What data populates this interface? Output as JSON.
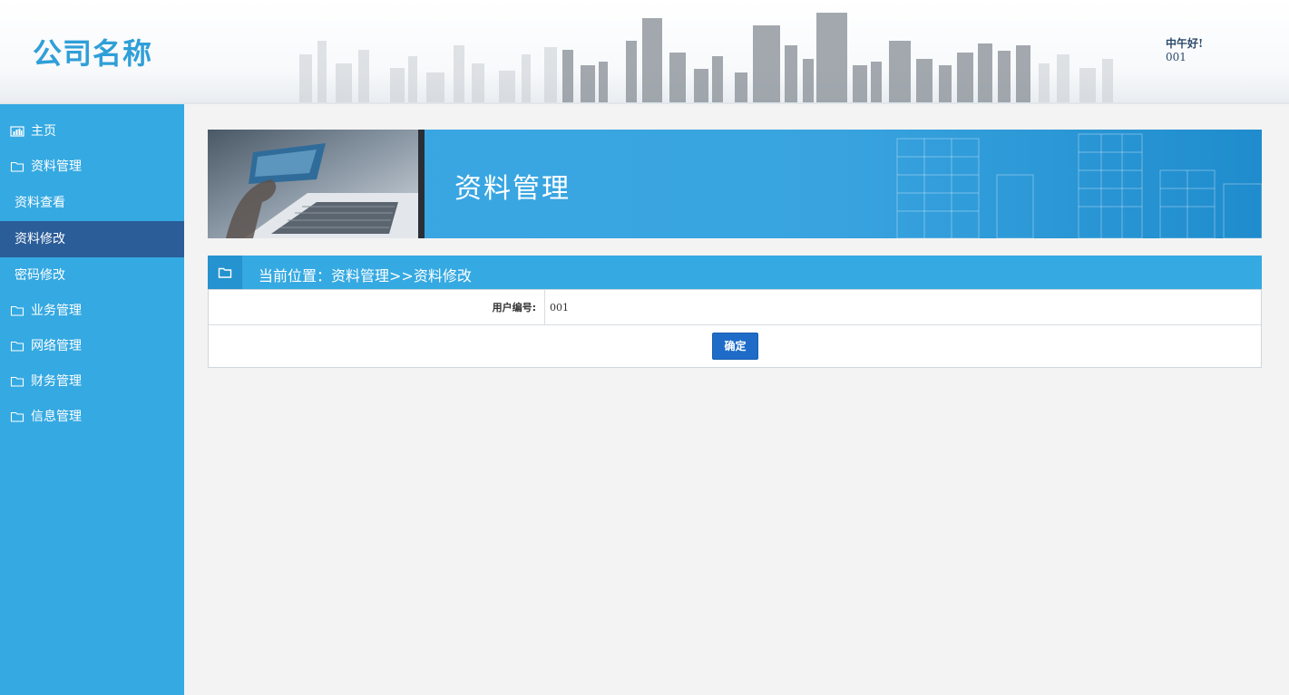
{
  "header": {
    "logo": "公司名称",
    "greeting": "中午好!",
    "user_id": "001"
  },
  "sidebar": {
    "items": [
      {
        "label": "主页",
        "icon": "bar-chart-icon"
      },
      {
        "label": "资料管理",
        "icon": "folder-icon"
      },
      {
        "label": "资料查看",
        "icon": null
      },
      {
        "label": "资料修改",
        "icon": null,
        "active": true
      },
      {
        "label": "密码修改",
        "icon": null
      },
      {
        "label": "业务管理",
        "icon": "folder-icon"
      },
      {
        "label": "网络管理",
        "icon": "folder-icon"
      },
      {
        "label": "财务管理",
        "icon": "folder-icon"
      },
      {
        "label": "信息管理",
        "icon": "folder-icon"
      }
    ]
  },
  "banner": {
    "title": "资料管理"
  },
  "breadcrumb": {
    "text": "当前位置：资料管理>>资料修改",
    "icon": "folder-icon"
  },
  "form": {
    "user_id_label": "用户编号:",
    "user_id_value": "001",
    "confirm_label": "确定"
  },
  "colors": {
    "sidebar": "#35a9e2",
    "sidebar_active": "#2b5d98",
    "accent": "#2f9fd8",
    "button": "#1e6cc8"
  }
}
